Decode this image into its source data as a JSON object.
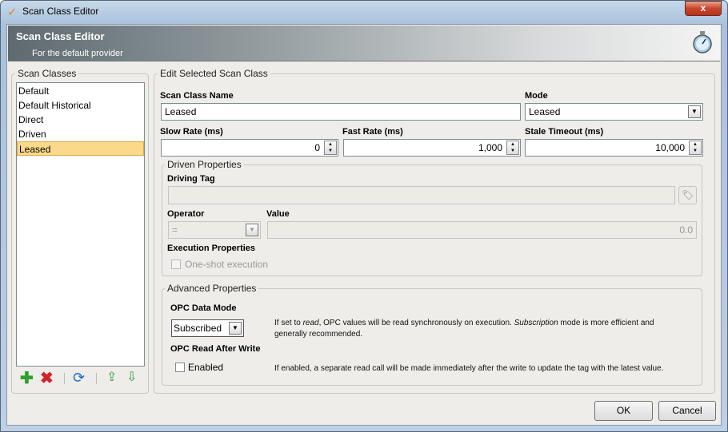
{
  "window": {
    "title": "Scan Class Editor",
    "close": "x"
  },
  "header": {
    "title": "Scan Class Editor",
    "subtitle": "For the default provider"
  },
  "scan_classes": {
    "legend": "Scan Classes",
    "items": [
      "Default",
      "Default Historical",
      "Direct",
      "Driven",
      "Leased"
    ],
    "selected": "Leased"
  },
  "edit": {
    "legend": "Edit Selected Scan Class",
    "name_label": "Scan Class Name",
    "name_value": "Leased",
    "mode_label": "Mode",
    "mode_value": "Leased",
    "slow_label": "Slow Rate (ms)",
    "slow_value": "0",
    "fast_label": "Fast Rate (ms)",
    "fast_value": "1,000",
    "stale_label": "Stale Timeout (ms)",
    "stale_value": "10,000"
  },
  "driven": {
    "legend": "Driven Properties",
    "driving_tag_label": "Driving Tag",
    "driving_tag_value": "",
    "operator_label": "Operator",
    "operator_value": "=",
    "value_label": "Value",
    "value_value": "0.0",
    "exec_label": "Execution Properties",
    "one_shot_label": "One-shot execution"
  },
  "advanced": {
    "legend": "Advanced Properties",
    "data_mode_label": "OPC Data Mode",
    "data_mode_value": "Subscribed",
    "data_mode_desc_1": "If set to ",
    "data_mode_desc_read": "read",
    "data_mode_desc_2": ", OPC values will be read synchronously on execution. ",
    "data_mode_desc_sub": "Subscription",
    "data_mode_desc_3": " mode is more efficient and",
    "data_mode_desc_4": "generally recommended.",
    "raw_label": "OPC Read After Write",
    "enabled_label": "Enabled",
    "raw_desc": "If enabled, a separate read call will be made immediately after the write to update the tag with the latest value."
  },
  "buttons": {
    "ok": "OK",
    "cancel": "Cancel"
  }
}
